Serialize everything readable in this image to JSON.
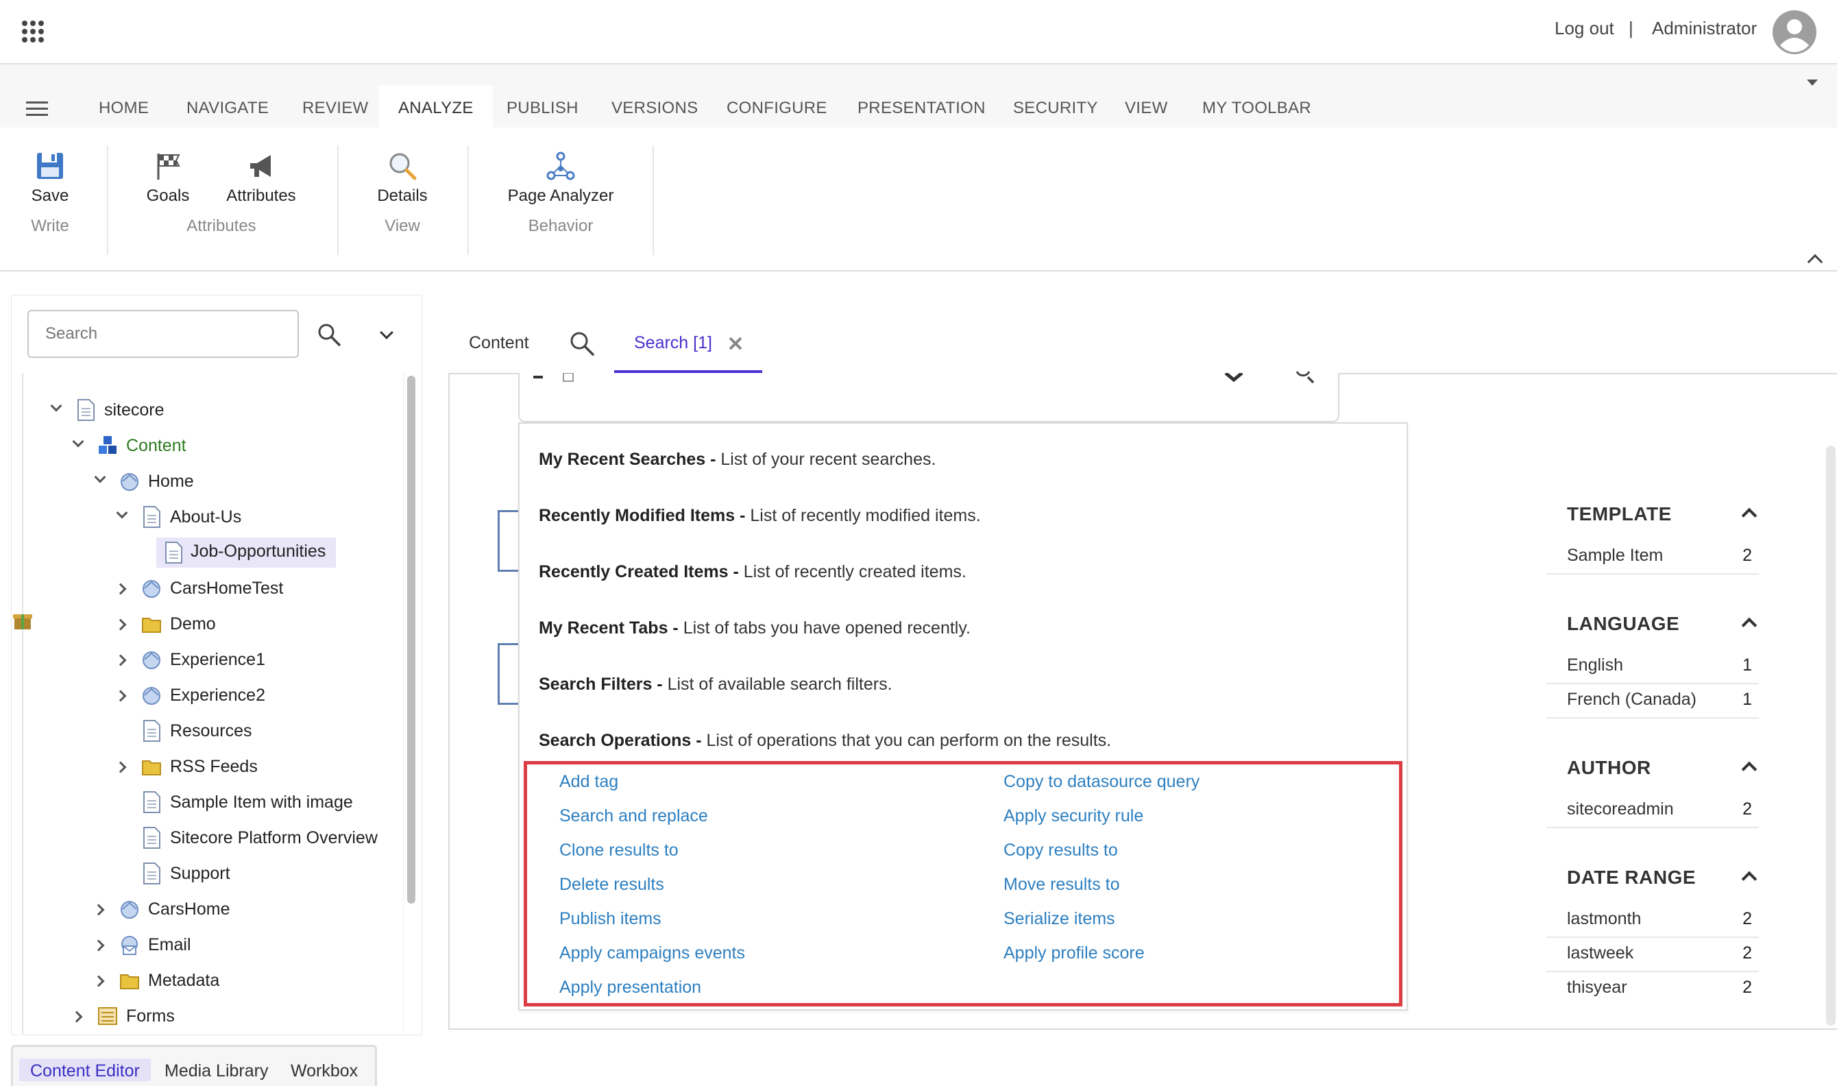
{
  "topbar": {
    "logout": "Log out",
    "separator": "|",
    "user": "Administrator"
  },
  "ribbon": {
    "tabs": [
      "HOME",
      "NAVIGATE",
      "REVIEW",
      "ANALYZE",
      "PUBLISH",
      "VERSIONS",
      "CONFIGURE",
      "PRESENTATION",
      "SECURITY",
      "VIEW",
      "MY TOOLBAR"
    ],
    "active_tab": "ANALYZE",
    "buttons": {
      "save": "Save",
      "goals": "Goals",
      "attributes": "Attributes",
      "details": "Details",
      "page_analyzer": "Page Analyzer"
    },
    "groups": {
      "write": "Write",
      "attributes": "Attributes",
      "view": "View",
      "behavior": "Behavior"
    }
  },
  "left": {
    "search_placeholder": "Search",
    "tree": [
      {
        "label": "sitecore"
      },
      {
        "label": "Content"
      },
      {
        "label": "Home"
      },
      {
        "label": "About-Us"
      },
      {
        "label": "Job-Opportunities"
      },
      {
        "label": "CarsHomeTest"
      },
      {
        "label": "Demo"
      },
      {
        "label": "Experience1"
      },
      {
        "label": "Experience2"
      },
      {
        "label": "Resources"
      },
      {
        "label": "RSS Feeds"
      },
      {
        "label": "Sample Item with image"
      },
      {
        "label": "Sitecore Platform Overview"
      },
      {
        "label": "Support"
      },
      {
        "label": "CarsHome"
      },
      {
        "label": "Email"
      },
      {
        "label": "Metadata"
      },
      {
        "label": "Forms"
      }
    ],
    "bottom_tabs": [
      "Content Editor",
      "Media Library",
      "Workbox"
    ]
  },
  "main": {
    "tabs": {
      "content": "Content",
      "search": "Search [1]"
    },
    "dropdown": [
      {
        "title": "My Recent Searches -",
        "desc": " List of your recent searches."
      },
      {
        "title": "Recently Modified Items -",
        "desc": " List of recently modified items."
      },
      {
        "title": "Recently Created Items -",
        "desc": " List of recently created items."
      },
      {
        "title": "My Recent Tabs -",
        "desc": " List of tabs you have opened recently."
      },
      {
        "title": "Search Filters -",
        "desc": " List of available search filters."
      },
      {
        "title": "Search Operations -",
        "desc": " List of operations that you can perform on the results."
      }
    ],
    "operations_left": [
      "Add tag",
      "Search and replace",
      "Clone results to",
      "Delete results",
      "Publish items",
      "Apply campaigns events",
      "Apply presentation"
    ],
    "operations_right": [
      "Copy to datasource query",
      "Apply security rule",
      "Copy results to",
      "Move results to",
      "Serialize items",
      "Apply profile score"
    ]
  },
  "facets": [
    {
      "title": "TEMPLATE",
      "rows": [
        {
          "name": "Sample Item",
          "count": "2"
        }
      ]
    },
    {
      "title": "LANGUAGE",
      "rows": [
        {
          "name": "English",
          "count": "1"
        },
        {
          "name": "French (Canada)",
          "count": "1"
        }
      ]
    },
    {
      "title": "AUTHOR",
      "rows": [
        {
          "name": "sitecoreadmin",
          "count": "2"
        }
      ]
    },
    {
      "title": "DATE RANGE",
      "rows": [
        {
          "name": "lastmonth",
          "count": "2"
        },
        {
          "name": "lastweek",
          "count": "2"
        },
        {
          "name": "thisyear",
          "count": "2"
        }
      ]
    }
  ],
  "colors": {
    "accent": "#4b2fd0",
    "link": "#2d7fc0",
    "highlight_border": "#dc3c44"
  }
}
